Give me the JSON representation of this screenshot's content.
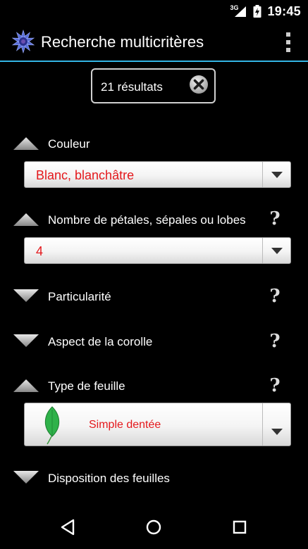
{
  "status_bar": {
    "network_type": "3G",
    "time": "19:45",
    "icons": [
      "signal-icon",
      "battery-icon"
    ]
  },
  "action_bar": {
    "title": "Recherche multicritères",
    "app_icon": "cornflower-icon",
    "overflow_icon": "more-vert-icon"
  },
  "results": {
    "count_text": "21 résultats",
    "clear_icon": "close-circle-icon"
  },
  "criteria": [
    {
      "label": "Couleur",
      "expanded": true,
      "has_help": false,
      "selected_value": "Blanc, blanchâtre"
    },
    {
      "label": "Nombre de pétales, sépales ou lobes",
      "expanded": true,
      "has_help": true,
      "help_text": "?",
      "selected_value": "4"
    },
    {
      "label": "Particularité",
      "expanded": false,
      "has_help": true,
      "help_text": "?"
    },
    {
      "label": "Aspect de la corolle",
      "expanded": false,
      "has_help": true,
      "help_text": "?"
    },
    {
      "label": "Type de feuille",
      "expanded": true,
      "has_help": true,
      "help_text": "?",
      "selected_value": "Simple dentée",
      "selected_icon": "leaf-icon"
    },
    {
      "label": "Disposition des feuilles",
      "expanded": false,
      "has_help": false
    }
  ],
  "nav_bar": {
    "back_icon": "back-triangle-icon",
    "home_icon": "home-circle-icon",
    "recents_icon": "recents-square-icon"
  },
  "colors": {
    "accent": "#33b5e5",
    "value_red": "#e4181c",
    "background": "#000000"
  }
}
